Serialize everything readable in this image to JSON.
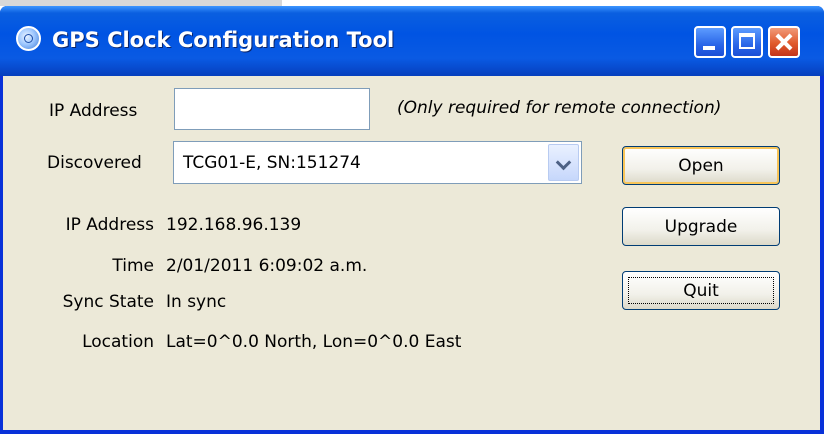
{
  "window": {
    "title": "GPS Clock Configuration Tool"
  },
  "form": {
    "ip_label": "IP Address",
    "ip_value": "",
    "ip_hint": "(Only required for remote connection)",
    "discovered_label": "Discovered",
    "discovered_value": "TCG01-E, SN:151274"
  },
  "info": {
    "ip_label": "IP Address",
    "ip_value": "192.168.96.139",
    "time_label": "Time",
    "time_value": "2/01/2011 6:09:02 a.m.",
    "sync_label": "Sync State",
    "sync_value": "In sync",
    "location_label": "Location",
    "location_value": "Lat=0^0.0 North, Lon=0^0.0 East"
  },
  "buttons": {
    "open": "Open",
    "upgrade": "Upgrade",
    "quit": "Quit"
  }
}
